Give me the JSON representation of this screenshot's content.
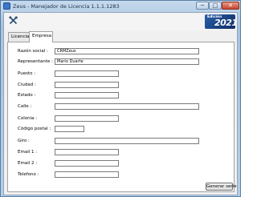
{
  "window": {
    "title": "Zeus - Manejador de Licencia 1.1.1.1283",
    "controls": {
      "minimize": "─",
      "maximize": "□",
      "close": "✕"
    }
  },
  "toolbar": {
    "icon": "tools-icon"
  },
  "badge": {
    "label": "Edición",
    "year": "2021"
  },
  "tabs": [
    {
      "label": "Licencias",
      "active": false
    },
    {
      "label": "Empresa",
      "active": true
    }
  ],
  "form": {
    "fields": [
      {
        "label": "Razón social :",
        "value": "CRMZeus"
      },
      {
        "label": "Representante :",
        "value": "Mario Duarte"
      },
      {
        "label": "Puesto :",
        "value": ""
      },
      {
        "label": "Ciudad :",
        "value": ""
      },
      {
        "label": "Estado :",
        "value": ""
      },
      {
        "label": "Calle :",
        "value": ""
      },
      {
        "label": "Colonia :",
        "value": ""
      },
      {
        "label": "Código postal :",
        "value": ""
      },
      {
        "label": "Giro :",
        "value": ""
      },
      {
        "label": "Email 1 :",
        "value": ""
      },
      {
        "label": "Email 2 :",
        "value": ""
      },
      {
        "label": "Telefono :",
        "value": ""
      }
    ],
    "submit_label": "Generar serie"
  },
  "colors": {
    "title_bar": "#b7cde6",
    "badge_bg": "#1c4589",
    "panel_bg": "#ffffff"
  }
}
